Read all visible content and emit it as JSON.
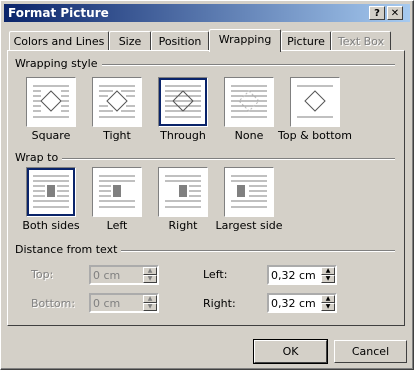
{
  "window": {
    "title": "Format Picture",
    "help_label": "?",
    "close_label": "✕"
  },
  "tabs": [
    {
      "label": "Colors and Lines"
    },
    {
      "label": "Size"
    },
    {
      "label": "Position"
    },
    {
      "label": "Wrapping",
      "active": true
    },
    {
      "label": "Picture"
    },
    {
      "label": "Text Box",
      "disabled": true
    }
  ],
  "wrapping_style": {
    "heading": "Wrapping style",
    "options": [
      {
        "label": "Square"
      },
      {
        "label": "Tight"
      },
      {
        "label": "Through",
        "selected": true
      },
      {
        "label": "None"
      },
      {
        "label": "Top & bottom"
      }
    ]
  },
  "wrap_to": {
    "heading": "Wrap to",
    "options": [
      {
        "label": "Both sides",
        "selected": true
      },
      {
        "label": "Left"
      },
      {
        "label": "Right"
      },
      {
        "label": "Largest side"
      }
    ]
  },
  "distance": {
    "heading": "Distance from text",
    "top_label": "Top:",
    "top_value": "0 cm",
    "bottom_label": "Bottom:",
    "bottom_value": "0 cm",
    "left_label": "Left:",
    "left_value": "0,32 cm",
    "right_label": "Right:",
    "right_value": "0,32 cm"
  },
  "buttons": {
    "ok_label": "OK",
    "cancel_label": "Cancel"
  }
}
